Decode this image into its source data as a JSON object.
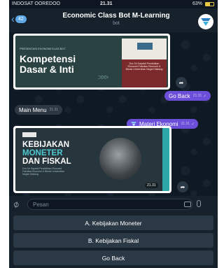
{
  "status_bar": {
    "carrier": "INDOSAT OOREDOO",
    "time": "21.31",
    "battery": "63%"
  },
  "header": {
    "back_count": "42",
    "title": "Economic Class Bot M-Learning",
    "subtitle": "bot"
  },
  "messages": {
    "image1": {
      "top_text": "PRESENTASI EKONOMI KLAS BOT",
      "title_line1": "Kompetensi",
      "title_line2": "Dasar & Inti",
      "cover_text": "Dra Sri Sayekti Pendidikan Ekonomi Fakultas Ekonomi & Bisnis Universitas Negeri Malang"
    },
    "go_back": {
      "text": "Go Back",
      "time": "21.31"
    },
    "main_menu": {
      "text": "Main Menu",
      "time": "21.31"
    },
    "materi": {
      "text": "Materi Ekonomi",
      "time": "21.31"
    },
    "image2": {
      "title_line1": "KEBIJAKAN",
      "title_line2": "MONETER",
      "title_line3": "DAN FISKAL",
      "sub_text": "Dra Sri Sayekti Pendidikan Ekonomi Fakultas Ekonomi & Bisnis Universitas Negeri Malang",
      "time": "21.31"
    }
  },
  "input": {
    "placeholder": "Pesan"
  },
  "keyboard": {
    "button1": "A. Kebijakan Moneter",
    "button2": "B. Kebijakan Fiskal",
    "button3": "Go Back"
  },
  "colors": {
    "accent": "#5ea8e8",
    "outgoing": "#6b4fd8",
    "background": "#0e1621"
  }
}
